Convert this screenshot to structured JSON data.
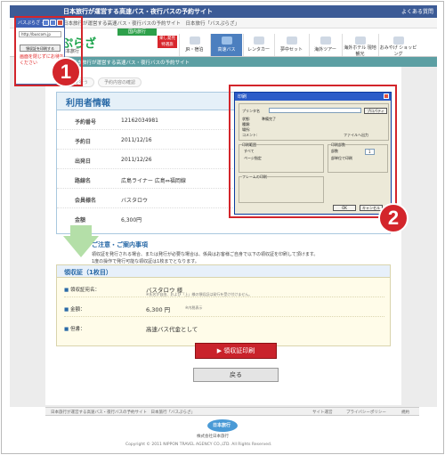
{
  "site": {
    "topbar_title": "日本旅行が運営する高速バス・夜行バスの予約サイト",
    "help_link": "よくある質問",
    "sub_nav": "日本旅行が運営する高速バス・夜行バスの予約サイト　日本旅行「バスぷらざ」",
    "logo_big": "ぷらざ",
    "logo_small": "日本旅行",
    "badge_green": "国内旅行",
    "badge_red": "楽し発見 特選旅",
    "tabs": [
      "JR・宿泊",
      "宿泊",
      "高速バス",
      "レンタカー",
      "夢中セット",
      "海外ツアー",
      "海外ホテル 現地観光",
      "おみやげ ショッピング"
    ],
    "teal_bar": "日本旅行が運営する高速バス・夜行バスの予約サイト"
  },
  "steps": [
    "予約を行う",
    "予約内容の確認"
  ],
  "user_info": {
    "header": "利用者情報",
    "rows": [
      {
        "label": "予約番号",
        "value": "12162034981"
      },
      {
        "label": "予約日",
        "value": "2011/12/16"
      },
      {
        "label": "出発日",
        "value": "2011/12/26"
      },
      {
        "label": "路線名",
        "value": "広島ライナー 広島⇔福岡線"
      },
      {
        "label": "会員様名",
        "value": "バスタロウ"
      },
      {
        "label": "金額",
        "value": "6,300円"
      }
    ]
  },
  "notice": {
    "title": "ご注意・ご案内事項",
    "line1": "領収証を発行される場合、または発行が必要な場合は、係員はお客様ご自身で以下の領収証を印刷して頂けます。",
    "line2": "1度の操作で発行可能な領収証は1枚までとなります。"
  },
  "receipt": {
    "header": "領収証（1枚目）",
    "rows": [
      {
        "label": "領収証宛名：",
        "value": "バスタロウ 様",
        "note": "※氏名が自由、および「上」様の領収証は発行を受け付けません。"
      },
      {
        "label": "金額：",
        "value": "6,300 円",
        "note": "※内税表示"
      },
      {
        "label": "但書：",
        "value": "高速バス代金として",
        "note": ""
      }
    ]
  },
  "buttons": {
    "print": "▶ 領収証印刷",
    "back": "戻る"
  },
  "footer": {
    "bar_left": "日本旅行が運営する高速バス・夜行バスの予約サイト　日本旅行「バスぷらざ」",
    "links": [
      "サイト運営",
      "プライバシーポリシー",
      "規約"
    ],
    "logo": "日本旅行",
    "company": "株式会社日本旅行",
    "copyright": "Copyright © 2011 NIPPON TRAVEL AGENCY CO.,LTD. All Rights Reserved."
  },
  "popup": {
    "title": "バスぷらざ - ...",
    "url": "http://buscom.jp",
    "button": "領収証を印刷する",
    "red_text": "画面を閉じずにお待ちください"
  },
  "print_dialog": {
    "title": "印刷",
    "printer_label": "プリンタ名",
    "status_label": "状態:",
    "status_value": "準備完了",
    "type_label": "種類:",
    "where_label": "場所:",
    "comment_label": "コメント:",
    "properties": "プロパティ",
    "print_to_file": "ファイルへ出力",
    "range_label": "印刷範囲",
    "all": "すべて",
    "pages": "ページ指定",
    "copies_label": "印刷部数",
    "copies_count": "部数",
    "copies_value": "1",
    "collate": "部単位で印刷",
    "frames_label": "フレームの印刷",
    "ok": "OK",
    "cancel": "キャンセル"
  },
  "annotations": {
    "one": "1",
    "two": "2"
  },
  "colors": {
    "nav": "#3c5b96",
    "accent": "#d3252b",
    "teal": "#5c9fa3",
    "panel_header": "#2a6aa7"
  }
}
